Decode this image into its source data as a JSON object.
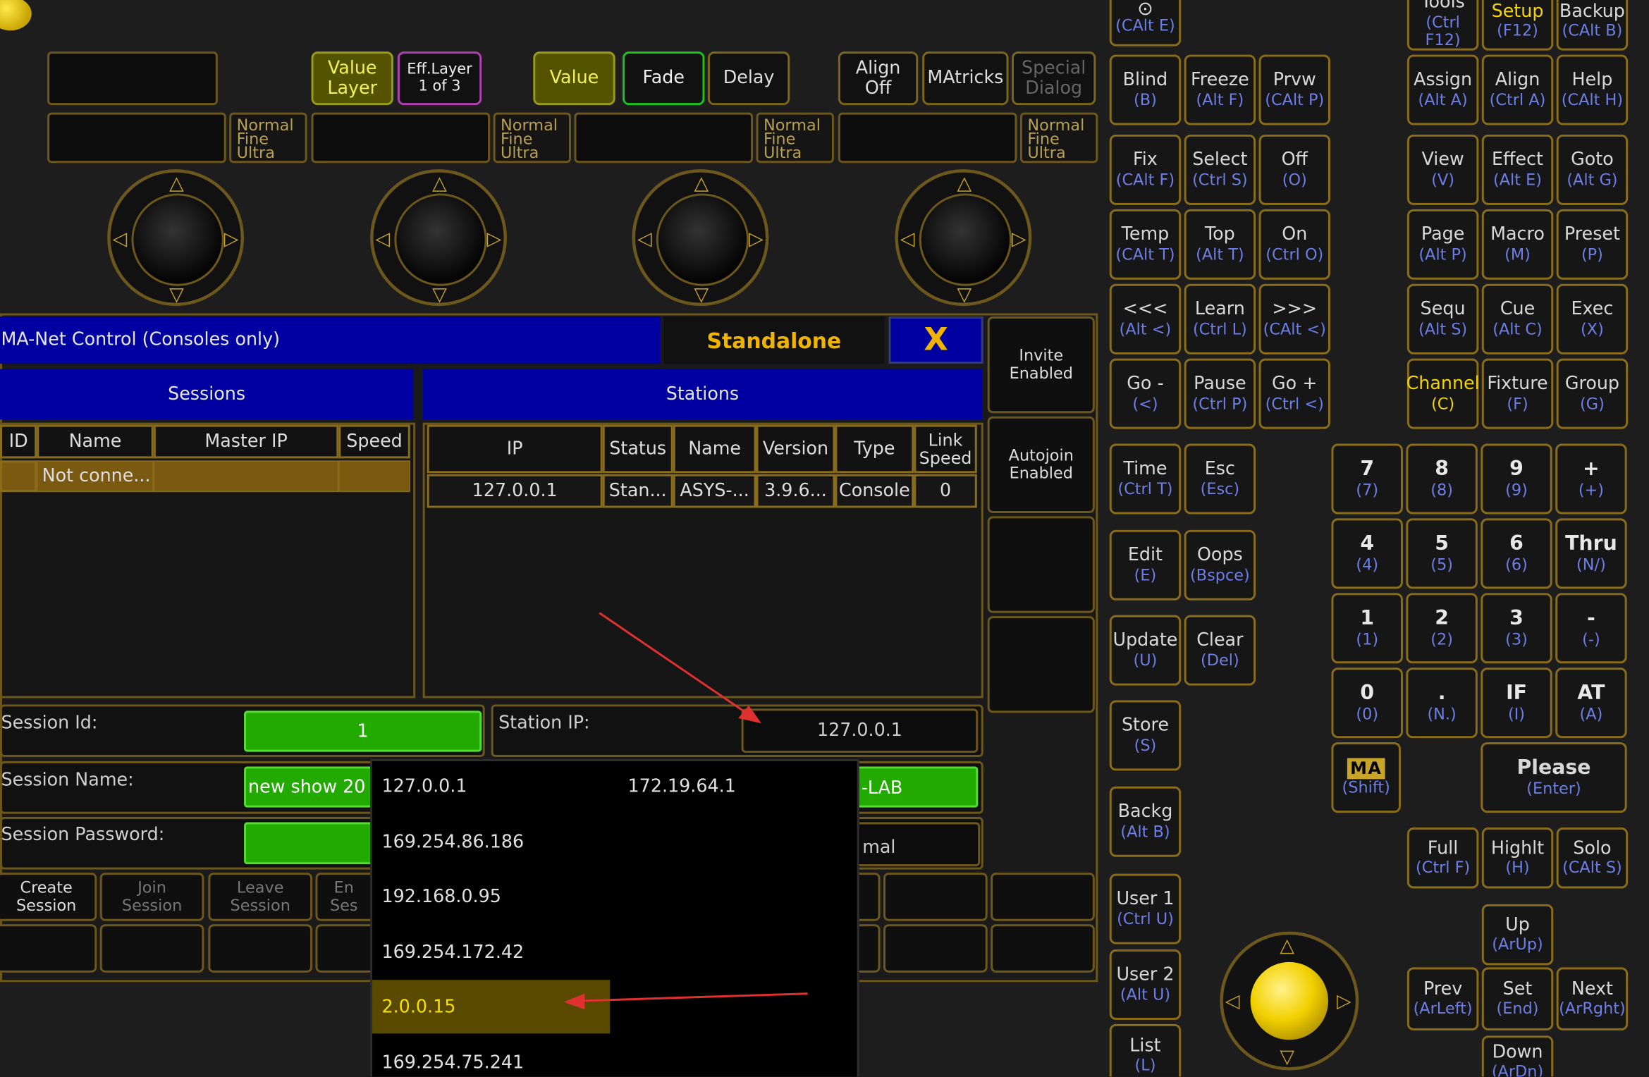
{
  "encoder_bar": {
    "value_layer": "Value Layer",
    "eff_layer": "Eff.Layer",
    "eff_layer_page": "1 of 3",
    "value": "Value",
    "fade": "Fade",
    "delay": "Delay",
    "align_off": "Align Off",
    "matricks": "MAtricks",
    "special_dialog": "Special Dialog",
    "resolution": [
      "Normal",
      "Fine",
      "Ultra"
    ]
  },
  "net_control": {
    "title": "MA-Net Control (Consoles only)",
    "mode": "Standalone",
    "close": "X",
    "side_buttons": [
      "Invite Enabled",
      "Autojoin Enabled"
    ],
    "sessions": {
      "tab": "Sessions",
      "columns": [
        "ID",
        "Name",
        "Master IP",
        "Speed"
      ],
      "rows": [
        [
          "",
          "Not conne...",
          "",
          ""
        ]
      ]
    },
    "stations": {
      "tab": "Stations",
      "columns": [
        "IP",
        "Status",
        "Name",
        "Version",
        "Type",
        "Link Speed"
      ],
      "rows": [
        [
          "127.0.0.1",
          "Stan...",
          "ASYS-...",
          "3.9.6...",
          "Console",
          "0"
        ]
      ]
    },
    "session_id_label": "Session Id:",
    "session_id": "1",
    "station_ip_label": "Station IP:",
    "station_ip": "127.0.0.1",
    "session_name_label": "Session Name:",
    "session_name": "new show 20",
    "session_name_right": "-LAB",
    "session_password_label": "Session Password:",
    "session_password_right": "mal",
    "buttons": [
      "Create Session",
      "Join Session",
      "Leave Session",
      "En Ses"
    ]
  },
  "ip_dropdown": {
    "items": [
      "127.0.0.1",
      "169.254.86.186",
      "192.168.0.95",
      "169.254.172.42",
      "2.0.0.15",
      "169.254.75.241"
    ],
    "items_right": [
      "172.19.64.1"
    ],
    "selected": "2.0.0.15"
  },
  "keys_middle": [
    {
      "l": "",
      "s": "(CAlt E)"
    },
    {
      "l": "Blind",
      "s": "(B)"
    },
    {
      "l": "Freeze",
      "s": "(Alt F)"
    },
    {
      "l": "Prvw",
      "s": "(CAlt P)"
    },
    {
      "l": "Fix",
      "s": "(CAlt F)"
    },
    {
      "l": "Select",
      "s": "(Ctrl S)"
    },
    {
      "l": "Off",
      "s": "(O)"
    },
    {
      "l": "Temp",
      "s": "(CAlt T)"
    },
    {
      "l": "Top",
      "s": "(Alt T)"
    },
    {
      "l": "On",
      "s": "(Ctrl O)"
    },
    {
      "l": "<<<",
      "s": "(Alt <)"
    },
    {
      "l": "Learn",
      "s": "(Ctrl L)"
    },
    {
      "l": ">>>",
      "s": "(CAlt <)"
    },
    {
      "l": "Go -",
      "s": "(<)"
    },
    {
      "l": "Pause",
      "s": "(Ctrl P)"
    },
    {
      "l": "Go +",
      "s": "(Ctrl <)"
    },
    {
      "l": "Time",
      "s": "(Ctrl T)"
    },
    {
      "l": "Esc",
      "s": "(Esc)"
    },
    {
      "l": "Edit",
      "s": "(E)"
    },
    {
      "l": "Oops",
      "s": "(Bspce)"
    },
    {
      "l": "Update",
      "s": "(U)"
    },
    {
      "l": "Clear",
      "s": "(Del)"
    },
    {
      "l": "Store",
      "s": "(S)"
    },
    {
      "l": "Backg",
      "s": "(Alt B)"
    },
    {
      "l": "User 1",
      "s": "(Ctrl U)"
    },
    {
      "l": "User 2",
      "s": "(Alt U)"
    },
    {
      "l": "List",
      "s": "(L)"
    }
  ],
  "keys_right": [
    {
      "l": "Tools",
      "s": "(Ctrl F12)"
    },
    {
      "l": "Setup",
      "s": "(F12)"
    },
    {
      "l": "Backup",
      "s": "(CAlt B)"
    },
    {
      "l": "Assign",
      "s": "(Alt A)"
    },
    {
      "l": "Align",
      "s": "(Ctrl A)"
    },
    {
      "l": "Help",
      "s": "(CAlt H)"
    },
    {
      "l": "View",
      "s": "(V)"
    },
    {
      "l": "Effect",
      "s": "(Alt E)"
    },
    {
      "l": "Goto",
      "s": "(Alt G)"
    },
    {
      "l": "Page",
      "s": "(Alt P)"
    },
    {
      "l": "Macro",
      "s": "(M)"
    },
    {
      "l": "Preset",
      "s": "(P)"
    },
    {
      "l": "Sequ",
      "s": "(Alt S)"
    },
    {
      "l": "Cue",
      "s": "(Alt C)"
    },
    {
      "l": "Exec",
      "s": "(X)"
    },
    {
      "l": "Channel",
      "s": "(C)"
    },
    {
      "l": "Fixture",
      "s": "(F)"
    },
    {
      "l": "Group",
      "s": "(G)"
    }
  ],
  "numpad": [
    {
      "l": "7",
      "s": "(7)"
    },
    {
      "l": "8",
      "s": "(8)"
    },
    {
      "l": "9",
      "s": "(9)"
    },
    {
      "l": "+",
      "s": "(+)"
    },
    {
      "l": "4",
      "s": "(4)"
    },
    {
      "l": "5",
      "s": "(5)"
    },
    {
      "l": "6",
      "s": "(6)"
    },
    {
      "l": "Thru",
      "s": "(N/)"
    },
    {
      "l": "1",
      "s": "(1)"
    },
    {
      "l": "2",
      "s": "(2)"
    },
    {
      "l": "3",
      "s": "(3)"
    },
    {
      "l": "-",
      "s": "(-)"
    },
    {
      "l": "0",
      "s": "(0)"
    },
    {
      "l": ".",
      "s": "(N.)"
    },
    {
      "l": "IF",
      "s": "(I)"
    },
    {
      "l": "AT",
      "s": "(A)"
    }
  ],
  "ma_key": {
    "logo": "MA",
    "s": "(Shift)"
  },
  "please_key": {
    "l": "Please",
    "s": "(Enter)"
  },
  "keys_bottom": [
    {
      "l": "Full",
      "s": "(Ctrl F)"
    },
    {
      "l": "Highlt",
      "s": "(H)"
    },
    {
      "l": "Solo",
      "s": "(CAlt S)"
    },
    {
      "l": "Up",
      "s": "(ArUp)"
    },
    {
      "l": "Prev",
      "s": "(ArLeft)"
    },
    {
      "l": "Set",
      "s": "(End)"
    },
    {
      "l": "Next",
      "s": "(ArRght)"
    },
    {
      "l": "Down",
      "s": "(ArDn)"
    }
  ]
}
